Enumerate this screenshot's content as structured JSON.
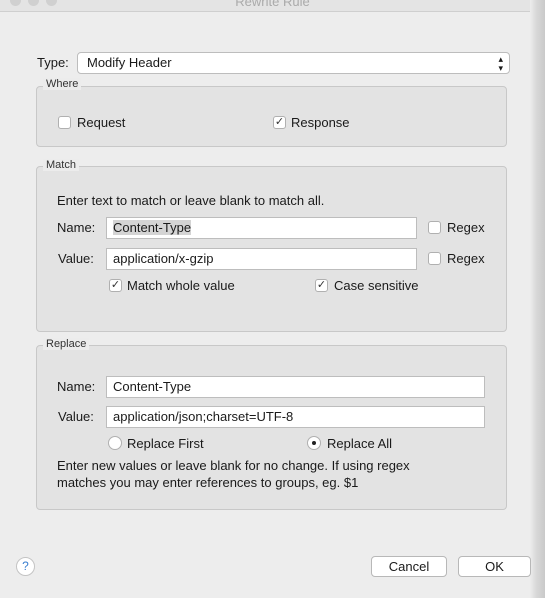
{
  "window": {
    "title": "Rewrite Rule"
  },
  "type": {
    "label": "Type:",
    "value": "Modify Header"
  },
  "where": {
    "legend": "Where",
    "request": {
      "label": "Request",
      "checked": false
    },
    "response": {
      "label": "Response",
      "checked": true
    }
  },
  "match": {
    "legend": "Match",
    "instructions": "Enter text to match or leave blank to match all.",
    "name_label": "Name:",
    "name_value": "Content-Type",
    "value_label": "Value:",
    "value_value": "application/x-gzip",
    "name_regex": {
      "label": "Regex",
      "checked": false
    },
    "value_regex": {
      "label": "Regex",
      "checked": false
    },
    "match_whole_value": {
      "label": "Match whole value",
      "checked": true
    },
    "case_sensitive": {
      "label": "Case sensitive",
      "checked": true
    }
  },
  "replace": {
    "legend": "Replace",
    "name_label": "Name:",
    "name_value": "Content-Type",
    "value_label": "Value:",
    "value_value": "application/json;charset=UTF-8",
    "replace_first": {
      "label": "Replace First",
      "selected": false
    },
    "replace_all": {
      "label": "Replace All",
      "selected": true
    },
    "help_line1": "Enter new values or leave blank for no change. If using regex",
    "help_line2": "matches you may enter references to groups, eg. $1"
  },
  "footer": {
    "help": "?",
    "cancel": "Cancel",
    "ok": "OK"
  },
  "icons": {
    "check": "✓",
    "updown": "⌃⌄"
  }
}
